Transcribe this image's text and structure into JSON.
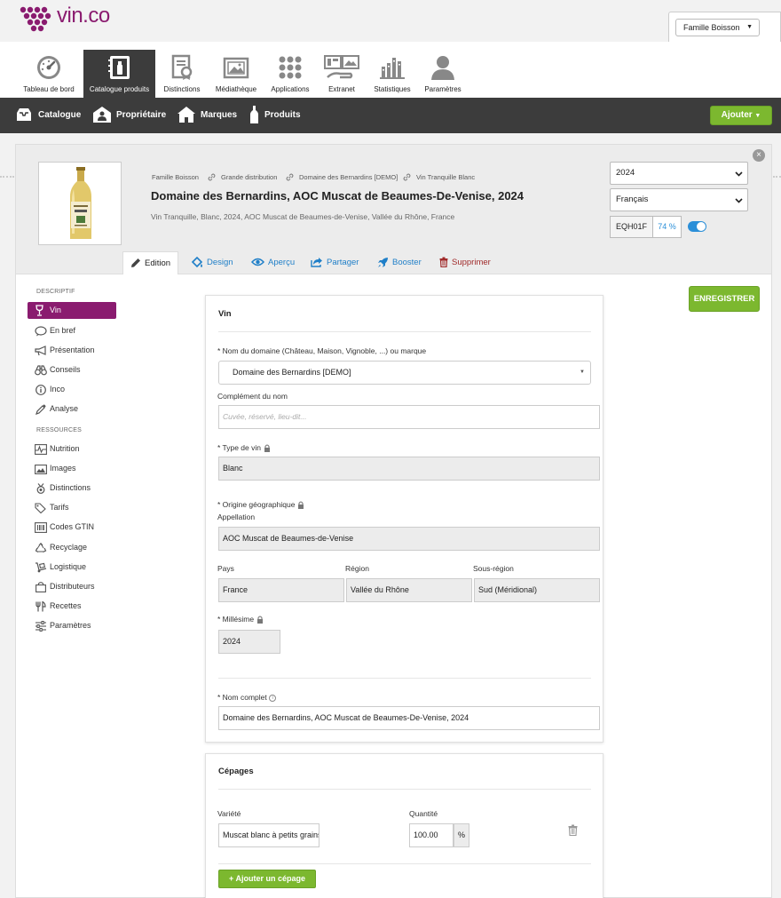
{
  "brand": {
    "name": "vin.co",
    "color": "#8a1b6f"
  },
  "account": {
    "label": "Famille Boisson"
  },
  "nav": [
    {
      "label": "Tableau de bord",
      "icon": "dashboard-icon"
    },
    {
      "label": "Catalogue produits",
      "icon": "catalogue-icon",
      "active": true
    },
    {
      "label": "Distinctions",
      "icon": "distinctions-icon"
    },
    {
      "label": "Médiathèque",
      "icon": "media-icon"
    },
    {
      "label": "Applications",
      "icon": "apps-icon"
    },
    {
      "label": "Extranet",
      "icon": "extranet-icon"
    },
    {
      "label": "Statistiques",
      "icon": "stats-icon"
    },
    {
      "label": "Paramètres",
      "icon": "user-icon"
    }
  ],
  "subnav": [
    {
      "label": "Catalogue",
      "icon": "tray-icon"
    },
    {
      "label": "Propriétaire",
      "icon": "owner-icon"
    },
    {
      "label": "Marques",
      "icon": "house-icon"
    },
    {
      "label": "Produits",
      "icon": "bottle-icon"
    }
  ],
  "add_button": "Ajouter",
  "product": {
    "breadcrumb": [
      "Famille Boisson",
      "Grande distribution",
      "Domaine des Bernardins [DEMO]",
      "Vin Tranquille Blanc"
    ],
    "title": "Domaine des Bernardins, AOC Muscat de Beaumes-De-Venise, 2024",
    "subtitle": "Vin Tranquille, Blanc, 2024, AOC Muscat de Beaumes-de-Venise, Vallée du Rhône, France",
    "vintage_select": "2024",
    "language_select": "Français",
    "code": "EQH01F",
    "completion": "74 %",
    "published": true
  },
  "tabs": [
    {
      "label": "Edition",
      "icon": "pencil-icon",
      "active": true
    },
    {
      "label": "Design",
      "icon": "paint-bucket-icon"
    },
    {
      "label": "Aperçu",
      "icon": "eye-icon"
    },
    {
      "label": "Partager",
      "icon": "share-icon"
    },
    {
      "label": "Booster",
      "icon": "rocket-icon"
    },
    {
      "label": "Supprimer",
      "icon": "trash-icon"
    }
  ],
  "save_button": "ENREGISTRER",
  "sidebar": {
    "descriptif_heading": "DESCRIPTIF",
    "descriptif": [
      {
        "label": "Vin",
        "icon": "wine-glass-icon",
        "active": true
      },
      {
        "label": "En bref",
        "icon": "speech-icon"
      },
      {
        "label": "Présentation",
        "icon": "megaphone-icon"
      },
      {
        "label": "Conseils",
        "icon": "binoculars-icon"
      },
      {
        "label": "Inco",
        "icon": "info-icon"
      },
      {
        "label": "Analyse",
        "icon": "pipette-icon"
      }
    ],
    "ressources_heading": "RESSOURCES",
    "ressources": [
      {
        "label": "Nutrition",
        "icon": "pulse-icon"
      },
      {
        "label": "Images",
        "icon": "images-icon"
      },
      {
        "label": "Distinctions",
        "icon": "medal-icon"
      },
      {
        "label": "Tarifs",
        "icon": "tags-icon"
      },
      {
        "label": "Codes GTIN",
        "icon": "barcode-icon"
      },
      {
        "label": "Recyclage",
        "icon": "recycle-icon"
      },
      {
        "label": "Logistique",
        "icon": "dolly-icon"
      },
      {
        "label": "Distributeurs",
        "icon": "bag-icon"
      },
      {
        "label": "Recettes",
        "icon": "utensils-icon"
      },
      {
        "label": "Paramètres",
        "icon": "sliders-icon"
      }
    ]
  },
  "vin": {
    "title": "Vin",
    "domain_label": "* Nom du domaine (Château, Maison, Vignoble, ...) ou marque",
    "domain_value": "Domaine des Bernardins [DEMO]",
    "complement_label": "Complément du nom",
    "complement_placeholder": "Cuvée, réservé, lieu-dit...",
    "type_label": "* Type de vin",
    "type_value": "Blanc",
    "origin_label": "* Origine géographique",
    "appellation_label": "Appellation",
    "appellation_value": "AOC Muscat de Beaumes-de-Venise",
    "pays_label": "Pays",
    "pays_value": "France",
    "region_label": "Région",
    "region_value": "Vallée du Rhône",
    "sousregion_label": "Sous-région",
    "sousregion_value": "Sud (Méridional)",
    "millesime_label": "* Millésime",
    "millesime_value": "2024",
    "fullname_label": "* Nom complet",
    "fullname_value": "Domaine des Bernardins, AOC Muscat de Beaumes-De-Venise, 2024"
  },
  "cepages": {
    "title": "Cépages",
    "variete_label": "Variété",
    "variete_value": "Muscat blanc à petits grains",
    "quantite_label": "Quantité",
    "quantite_value": "100.00",
    "unit": "%",
    "add_label": "Ajouter un cépage"
  }
}
